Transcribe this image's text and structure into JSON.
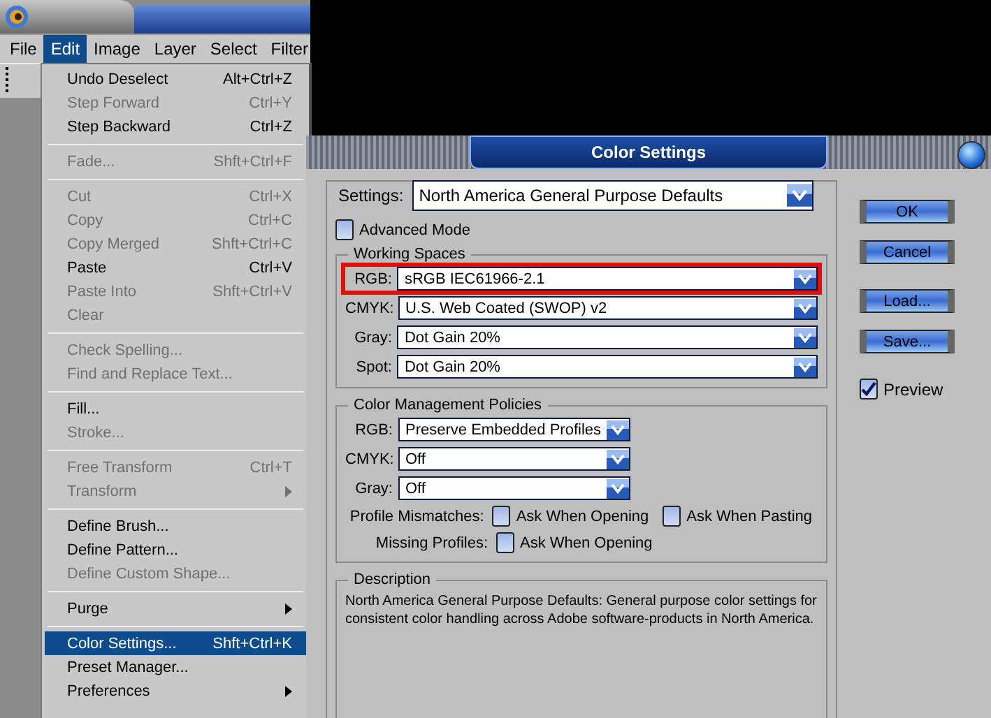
{
  "menubar": [
    {
      "label": "File",
      "selected": false
    },
    {
      "label": "Edit",
      "selected": true
    },
    {
      "label": "Image",
      "selected": false
    },
    {
      "label": "Layer",
      "selected": false
    },
    {
      "label": "Select",
      "selected": false
    },
    {
      "label": "Filter",
      "selected": false
    }
  ],
  "edit_menu": {
    "groups": [
      [
        {
          "label": "Undo Deselect",
          "shortcut": "Alt+Ctrl+Z",
          "disabled": false,
          "submenu": false,
          "selected": false
        },
        {
          "label": "Step Forward",
          "shortcut": "Ctrl+Y",
          "disabled": true,
          "submenu": false,
          "selected": false
        },
        {
          "label": "Step Backward",
          "shortcut": "Ctrl+Z",
          "disabled": false,
          "submenu": false,
          "selected": false
        }
      ],
      [
        {
          "label": "Fade...",
          "shortcut": "Shft+Ctrl+F",
          "disabled": true,
          "submenu": false,
          "selected": false
        }
      ],
      [
        {
          "label": "Cut",
          "shortcut": "Ctrl+X",
          "disabled": true,
          "submenu": false,
          "selected": false
        },
        {
          "label": "Copy",
          "shortcut": "Ctrl+C",
          "disabled": true,
          "submenu": false,
          "selected": false
        },
        {
          "label": "Copy Merged",
          "shortcut": "Shft+Ctrl+C",
          "disabled": true,
          "submenu": false,
          "selected": false
        },
        {
          "label": "Paste",
          "shortcut": "Ctrl+V",
          "disabled": false,
          "submenu": false,
          "selected": false
        },
        {
          "label": "Paste Into",
          "shortcut": "Shft+Ctrl+V",
          "disabled": true,
          "submenu": false,
          "selected": false
        },
        {
          "label": "Clear",
          "disabled": true,
          "submenu": false,
          "selected": false
        }
      ],
      [
        {
          "label": "Check Spelling...",
          "disabled": true,
          "submenu": false,
          "selected": false
        },
        {
          "label": "Find and Replace Text...",
          "disabled": true,
          "submenu": false,
          "selected": false
        }
      ],
      [
        {
          "label": "Fill...",
          "disabled": false,
          "submenu": false,
          "selected": false
        },
        {
          "label": "Stroke...",
          "disabled": true,
          "submenu": false,
          "selected": false
        }
      ],
      [
        {
          "label": "Free Transform",
          "shortcut": "Ctrl+T",
          "disabled": true,
          "submenu": false,
          "selected": false
        },
        {
          "label": "Transform",
          "disabled": true,
          "submenu": true,
          "selected": false
        }
      ],
      [
        {
          "label": "Define Brush...",
          "disabled": false,
          "submenu": false,
          "selected": false
        },
        {
          "label": "Define Pattern...",
          "disabled": false,
          "submenu": false,
          "selected": false
        },
        {
          "label": "Define Custom Shape...",
          "disabled": true,
          "submenu": false,
          "selected": false
        }
      ],
      [
        {
          "label": "Purge",
          "disabled": false,
          "submenu": true,
          "selected": false
        }
      ],
      [
        {
          "label": "Color Settings...",
          "shortcut": "Shft+Ctrl+K",
          "disabled": false,
          "submenu": false,
          "selected": true
        },
        {
          "label": "Preset Manager...",
          "disabled": false,
          "submenu": false,
          "selected": false
        },
        {
          "label": "Preferences",
          "disabled": false,
          "submenu": true,
          "selected": false
        }
      ]
    ]
  },
  "dialog": {
    "title": "Color Settings",
    "settings": {
      "label": "Settings:",
      "value": "North America General Purpose Defaults"
    },
    "advanced_mode": {
      "label": "Advanced Mode",
      "checked": false
    },
    "working_spaces": {
      "title": "Working Spaces",
      "fields": [
        {
          "label": "RGB:",
          "value": "sRGB IEC61966-2.1",
          "highlighted": true
        },
        {
          "label": "CMYK:",
          "value": "U.S. Web Coated (SWOP) v2",
          "highlighted": false
        },
        {
          "label": "Gray:",
          "value": "Dot Gain 20%",
          "highlighted": false
        },
        {
          "label": "Spot:",
          "value": "Dot Gain 20%",
          "highlighted": false
        }
      ]
    },
    "policies": {
      "title": "Color Management Policies",
      "fields": [
        {
          "label": "RGB:",
          "value": "Preserve Embedded Profiles"
        },
        {
          "label": "CMYK:",
          "value": "Off"
        },
        {
          "label": "Gray:",
          "value": "Off"
        }
      ],
      "checks": [
        {
          "label": "Profile Mismatches:",
          "options": [
            {
              "label": "Ask When Opening",
              "checked": false
            },
            {
              "label": "Ask When Pasting",
              "checked": false
            }
          ]
        },
        {
          "label": "Missing Profiles:",
          "options": [
            {
              "label": "Ask When Opening",
              "checked": false
            }
          ]
        }
      ]
    },
    "description": {
      "title": "Description",
      "text": "North America General Purpose Defaults:  General purpose color settings for consistent color handling across Adobe software-products in North America."
    },
    "button_groups": [
      [
        "OK",
        "Cancel"
      ],
      [
        "Load...",
        "Save..."
      ]
    ],
    "preview": {
      "label": "Preview",
      "checked": true
    }
  }
}
